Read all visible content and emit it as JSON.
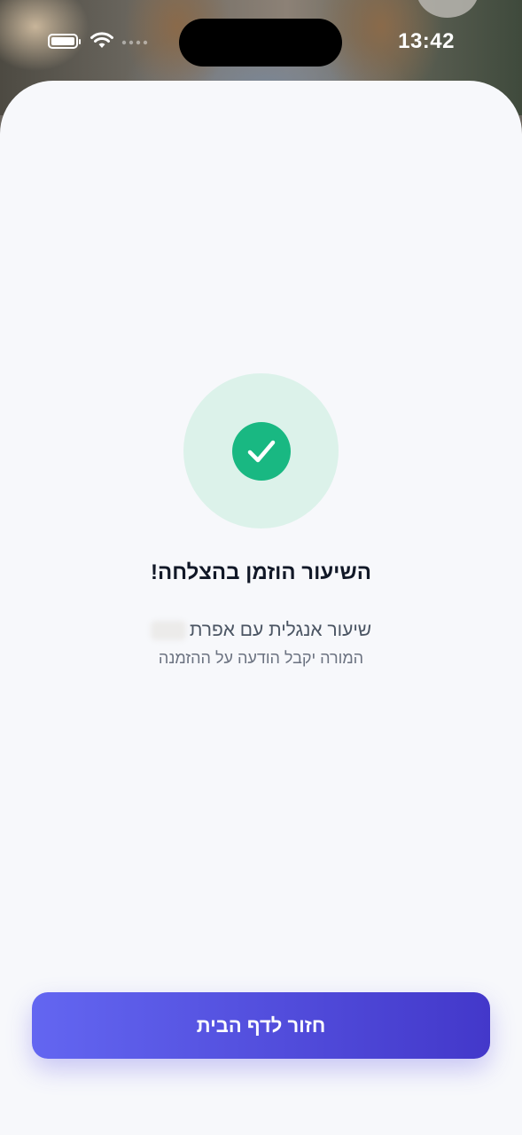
{
  "status_bar": {
    "time": "13:42",
    "icons": [
      "battery-icon",
      "wifi-icon",
      "cellular-signal-icon"
    ]
  },
  "confirmation": {
    "icon": "check-circle-icon",
    "title": "השיעור הוזמן בהצלחה!",
    "lesson_line": "שיעור אנגלית עם אפרת",
    "note": "המורה יקבל הודעה על ההזמנה"
  },
  "actions": {
    "home_button_label": "חזור לדף הבית"
  },
  "colors": {
    "accent": "#4f46e5",
    "success": "#19b882",
    "success_bg": "#dcf2ea",
    "sheet_bg": "#f7f8fb"
  }
}
